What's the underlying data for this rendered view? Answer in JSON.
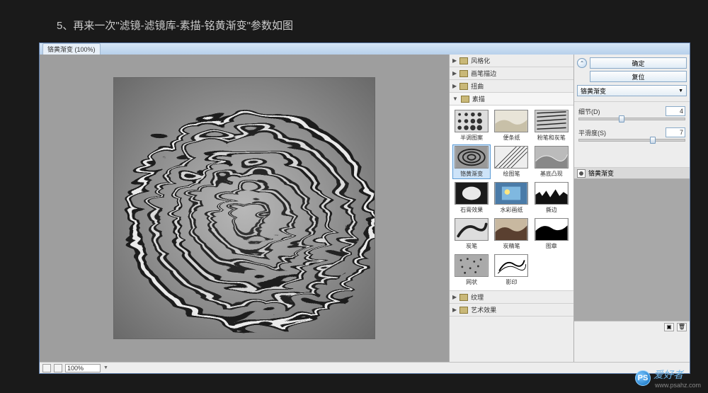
{
  "caption": "5、再来一次\"滤镜-滤镜库-素描-铭黄渐变\"参数如图",
  "window": {
    "title": "铬黄渐变 (100%)",
    "zoom": "100%"
  },
  "folders": {
    "f1": "风格化",
    "f2": "画笔描边",
    "f3": "扭曲",
    "f4": "素描",
    "f5": "纹理",
    "f6": "艺术效果"
  },
  "thumbs": {
    "t0": "半调图案",
    "t1": "便条纸",
    "t2": "粉笔和炭笔",
    "t3": "铬黄渐变",
    "t4": "绘图笔",
    "t5": "基底凸现",
    "t6": "石膏效果",
    "t7": "水彩画纸",
    "t8": "撕边",
    "t9": "炭笔",
    "t10": "炭精笔",
    "t11": "图章",
    "t12": "网状",
    "t13": "影印"
  },
  "right": {
    "ok": "确定",
    "cancel": "复位",
    "effect_select": "铬黄渐变",
    "slider1_label": "细节(D)",
    "slider1_value": "4",
    "slider2_label": "平滑度(S)",
    "slider2_value": "7",
    "layer_name": "铬黄渐变"
  },
  "watermark": {
    "logo": "PS",
    "text": "爱好者",
    "url": "www.psahz.com"
  }
}
